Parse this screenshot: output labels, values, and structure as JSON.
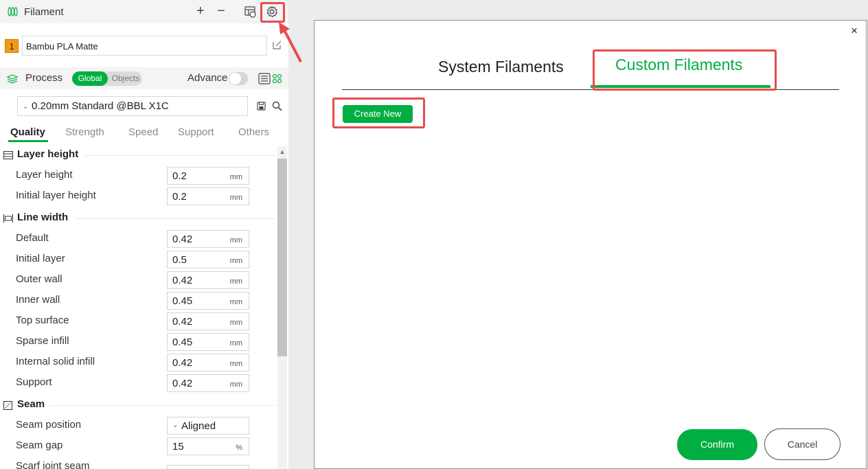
{
  "filament": {
    "title": "Filament",
    "add": "+",
    "remove": "−",
    "slot_number": "1",
    "selected": "Bambu PLA Matte"
  },
  "process": {
    "title": "Process",
    "global_label": "Global",
    "objects_label": "Objects",
    "advance_label": "Advance",
    "preset": "0.20mm Standard @BBL X1C"
  },
  "tabs": [
    "Quality",
    "Strength",
    "Speed",
    "Support",
    "Others"
  ],
  "sections": {
    "layer_height": {
      "title": "Layer height",
      "rows": [
        {
          "label": "Layer height",
          "value": "0.2",
          "unit": "mm"
        },
        {
          "label": "Initial layer height",
          "value": "0.2",
          "unit": "mm"
        }
      ]
    },
    "line_width": {
      "title": "Line width",
      "rows": [
        {
          "label": "Default",
          "value": "0.42",
          "unit": "mm"
        },
        {
          "label": "Initial layer",
          "value": "0.5",
          "unit": "mm"
        },
        {
          "label": "Outer wall",
          "value": "0.42",
          "unit": "mm"
        },
        {
          "label": "Inner wall",
          "value": "0.45",
          "unit": "mm"
        },
        {
          "label": "Top surface",
          "value": "0.42",
          "unit": "mm"
        },
        {
          "label": "Sparse infill",
          "value": "0.45",
          "unit": "mm"
        },
        {
          "label": "Internal solid infill",
          "value": "0.42",
          "unit": "mm"
        },
        {
          "label": "Support",
          "value": "0.42",
          "unit": "mm"
        }
      ]
    },
    "seam": {
      "title": "Seam",
      "rows": [
        {
          "label": "Seam position",
          "value": "Aligned",
          "unit": ""
        },
        {
          "label": "Seam gap",
          "value": "15",
          "unit": "%"
        },
        {
          "label": "Scarf joint seam",
          "value": "",
          "unit": ""
        }
      ]
    }
  },
  "dialog": {
    "tab_system": "System Filaments",
    "tab_custom": "Custom Filaments",
    "create_new": "Create New",
    "confirm": "Confirm",
    "cancel": "Cancel",
    "close": "×"
  },
  "colors": {
    "accent": "#00ae42",
    "highlight": "#e74c4c",
    "slot": "#f39c12"
  }
}
